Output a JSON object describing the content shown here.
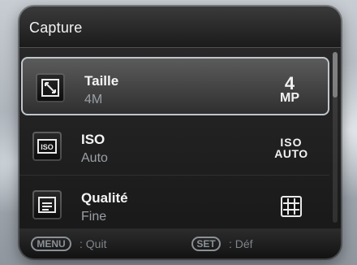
{
  "screen": {
    "title": "Capture"
  },
  "menu": {
    "items": [
      {
        "label": "Taille",
        "value": "4M",
        "right_icon": "size-4mp-icon",
        "right_text_primary": "4",
        "right_text_secondary": "MP",
        "left_icon": "resize-icon"
      },
      {
        "label": "ISO",
        "value": "Auto",
        "right_icon": "iso-auto-icon",
        "right_text_primary": "ISO",
        "right_text_secondary": "AUTO",
        "left_icon": "iso-icon"
      },
      {
        "label": "Qualité",
        "value": "Fine",
        "right_icon": "quality-grid-icon",
        "left_icon": "quality-icon"
      }
    ],
    "selected_index": 0
  },
  "footer": {
    "menu_key": "MENU",
    "quit_label": ": Quit",
    "set_key": "SET",
    "def_label": ": Déf"
  }
}
